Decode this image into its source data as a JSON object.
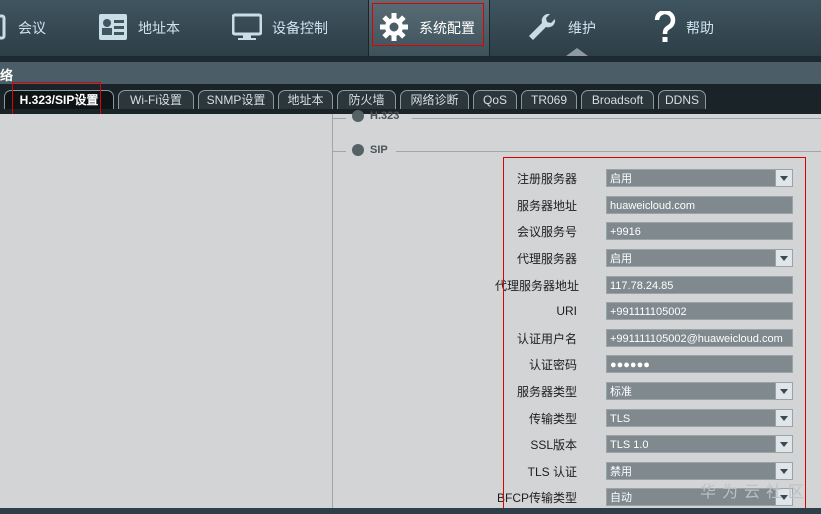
{
  "nav": {
    "items": [
      {
        "label": "会议",
        "icon": "meeting-icon"
      },
      {
        "label": "地址本",
        "icon": "address-book-icon"
      },
      {
        "label": "设备控制",
        "icon": "monitor-icon"
      },
      {
        "label": "系统配置",
        "icon": "gear-icon",
        "active": true
      },
      {
        "label": "维护",
        "icon": "wrench-icon"
      },
      {
        "label": "帮助",
        "icon": "help-icon"
      }
    ]
  },
  "subbar": {
    "title": "络"
  },
  "tabs": [
    {
      "label": "H.323/SIP设置",
      "active": true
    },
    {
      "label": "Wi-Fi设置"
    },
    {
      "label": "SNMP设置"
    },
    {
      "label": "地址本"
    },
    {
      "label": "防火墙"
    },
    {
      "label": "网络诊断"
    },
    {
      "label": "QoS"
    },
    {
      "label": "TR069"
    },
    {
      "label": "Broadsoft"
    },
    {
      "label": "DDNS"
    }
  ],
  "sections": {
    "h323": {
      "legend": "H.323"
    },
    "sip": {
      "legend": "SIP"
    }
  },
  "fields": [
    {
      "label": "注册服务器",
      "value": "启用",
      "type": "select"
    },
    {
      "label": "服务器地址",
      "value": "huaweicloud.com",
      "type": "input"
    },
    {
      "label": "会议服务号",
      "value": "+9916",
      "type": "input"
    },
    {
      "label": "代理服务器",
      "value": "启用",
      "type": "select"
    },
    {
      "label": "代理服务器地址",
      "value": "117.78.24.85",
      "type": "input"
    },
    {
      "label": "URI",
      "value": "+991111105002",
      "type": "input"
    },
    {
      "label": "认证用户名",
      "value": "+991111105002@huaweicloud.com",
      "type": "input"
    },
    {
      "label": "认证密码",
      "value": "●●●●●●",
      "type": "input"
    },
    {
      "label": "服务器类型",
      "value": "标准",
      "type": "select"
    },
    {
      "label": "传输类型",
      "value": "TLS",
      "type": "select"
    },
    {
      "label": "SSL版本",
      "value": "TLS 1.0",
      "type": "select"
    },
    {
      "label": "TLS 认证",
      "value": "禁用",
      "type": "select"
    },
    {
      "label": "BFCP传输类型",
      "value": "自动",
      "type": "select"
    }
  ],
  "watermark": "华为云社区",
  "colors": {
    "highlight": "#e00000",
    "nav_bg": "#2d3e47"
  }
}
